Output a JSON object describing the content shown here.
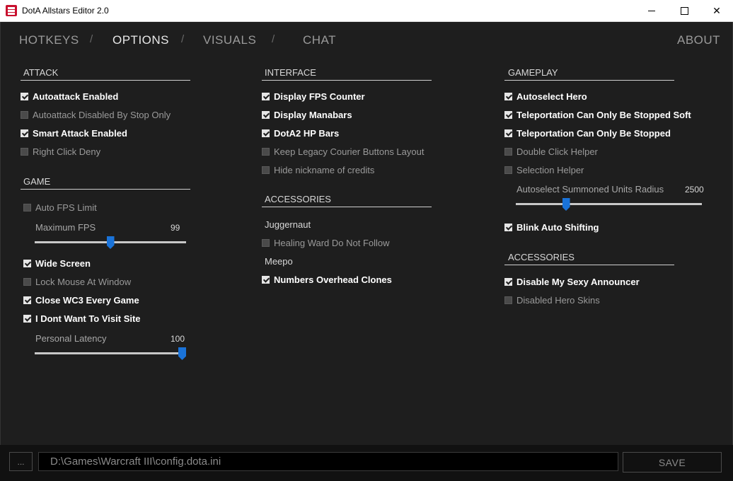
{
  "window": {
    "title": "DotA Allstars Editor 2.0"
  },
  "nav": {
    "hotkeys": "HOTKEYS",
    "options": "OPTIONS",
    "visuals": "VISUALS",
    "chat": "CHAT",
    "about": "ABOUT",
    "sep": "/"
  },
  "attack": {
    "title": "ATTACK",
    "items": [
      {
        "label": "Autoattack Enabled",
        "checked": true
      },
      {
        "label": "Autoattack Disabled By Stop Only",
        "checked": false
      },
      {
        "label": "Smart Attack Enabled",
        "checked": true
      },
      {
        "label": "Right Click Deny",
        "checked": false
      }
    ]
  },
  "game": {
    "title": "GAME",
    "auto_fps": {
      "label": "Auto FPS Limit",
      "checked": false
    },
    "max_fps": {
      "label": "Maximum FPS",
      "value": "99",
      "fraction": 0.5
    },
    "items": [
      {
        "label": "Wide Screen",
        "checked": true
      },
      {
        "label": "Lock Mouse At Window",
        "checked": false
      },
      {
        "label": "Close WC3 Every Game",
        "checked": true
      },
      {
        "label": "I Dont Want To Visit Site",
        "checked": true
      }
    ],
    "latency": {
      "label": "Personal Latency",
      "value": "100",
      "fraction": 1.0
    }
  },
  "interface": {
    "title": "INTERFACE",
    "items": [
      {
        "label": "Display FPS Counter",
        "checked": true
      },
      {
        "label": "Display Manabars",
        "checked": true
      },
      {
        "label": "DotA2 HP Bars",
        "checked": true
      },
      {
        "label": "Keep Legacy Courier Buttons Layout",
        "checked": false
      },
      {
        "label": "Hide nickname of credits",
        "checked": false
      }
    ]
  },
  "accessories_mid": {
    "title": "ACCESSORIES",
    "juggernaut": "Juggernaut",
    "healing_ward": {
      "label": "Healing Ward Do Not Follow",
      "checked": false
    },
    "meepo": "Meepo",
    "numbers_overhead": {
      "label": "Numbers Overhead Clones",
      "checked": true
    }
  },
  "gameplay": {
    "title": "GAMEPLAY",
    "items": [
      {
        "label": "Autoselect Hero",
        "checked": true
      },
      {
        "label": "Teleportation Can Only Be Stopped Soft",
        "checked": true
      },
      {
        "label": "Teleportation Can Only Be Stopped",
        "checked": true
      },
      {
        "label": "Double Click Helper",
        "checked": false
      },
      {
        "label": "Selection Helper",
        "checked": false
      }
    ],
    "radius": {
      "label": "Autoselect Summoned Units Radius",
      "value": "2500",
      "fraction": 0.26
    },
    "blink": {
      "label": "Blink Auto Shifting",
      "checked": true
    }
  },
  "accessories_right": {
    "title": "ACCESSORIES",
    "items": [
      {
        "label": "Disable My Sexy Announcer",
        "checked": true
      },
      {
        "label": "Disabled Hero Skins",
        "checked": false
      }
    ]
  },
  "footer": {
    "browse_label": "...",
    "path": "D:\\Games\\Warcraft III\\config.dota.ini",
    "save_label": "SAVE"
  }
}
